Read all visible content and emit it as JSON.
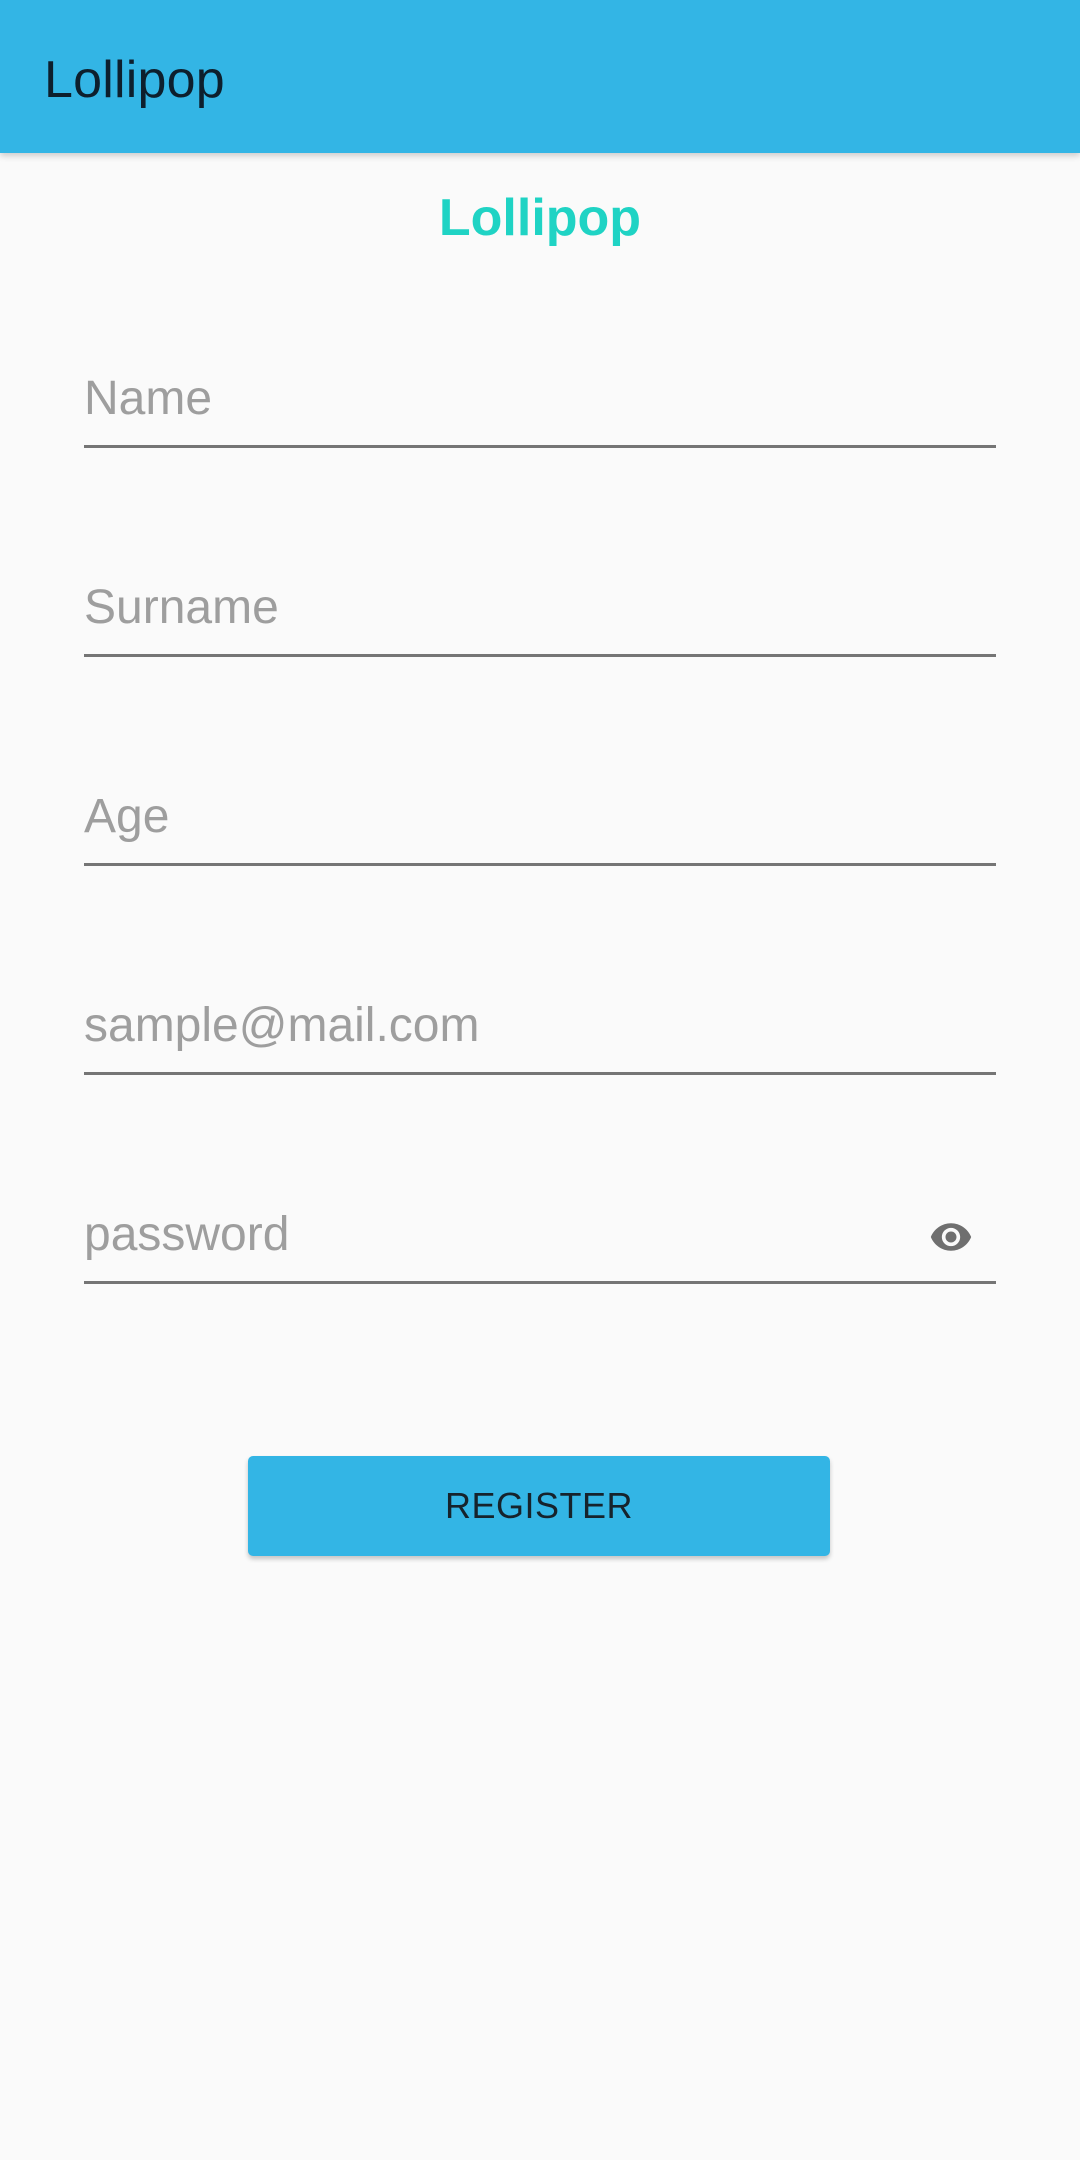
{
  "app_bar": {
    "title": "Lollipop",
    "color": "#33b5e5"
  },
  "heading": {
    "text": "Lollipop",
    "color": "#1fd3c4"
  },
  "form": {
    "name_placeholder": "Name",
    "surname_placeholder": "Surname",
    "age_placeholder": "Age",
    "email_placeholder": "sample@mail.com",
    "password_placeholder": "password",
    "password_toggle_icon": "eye-icon"
  },
  "register_button": {
    "label": "REGISTER",
    "color": "#33b5e5"
  }
}
